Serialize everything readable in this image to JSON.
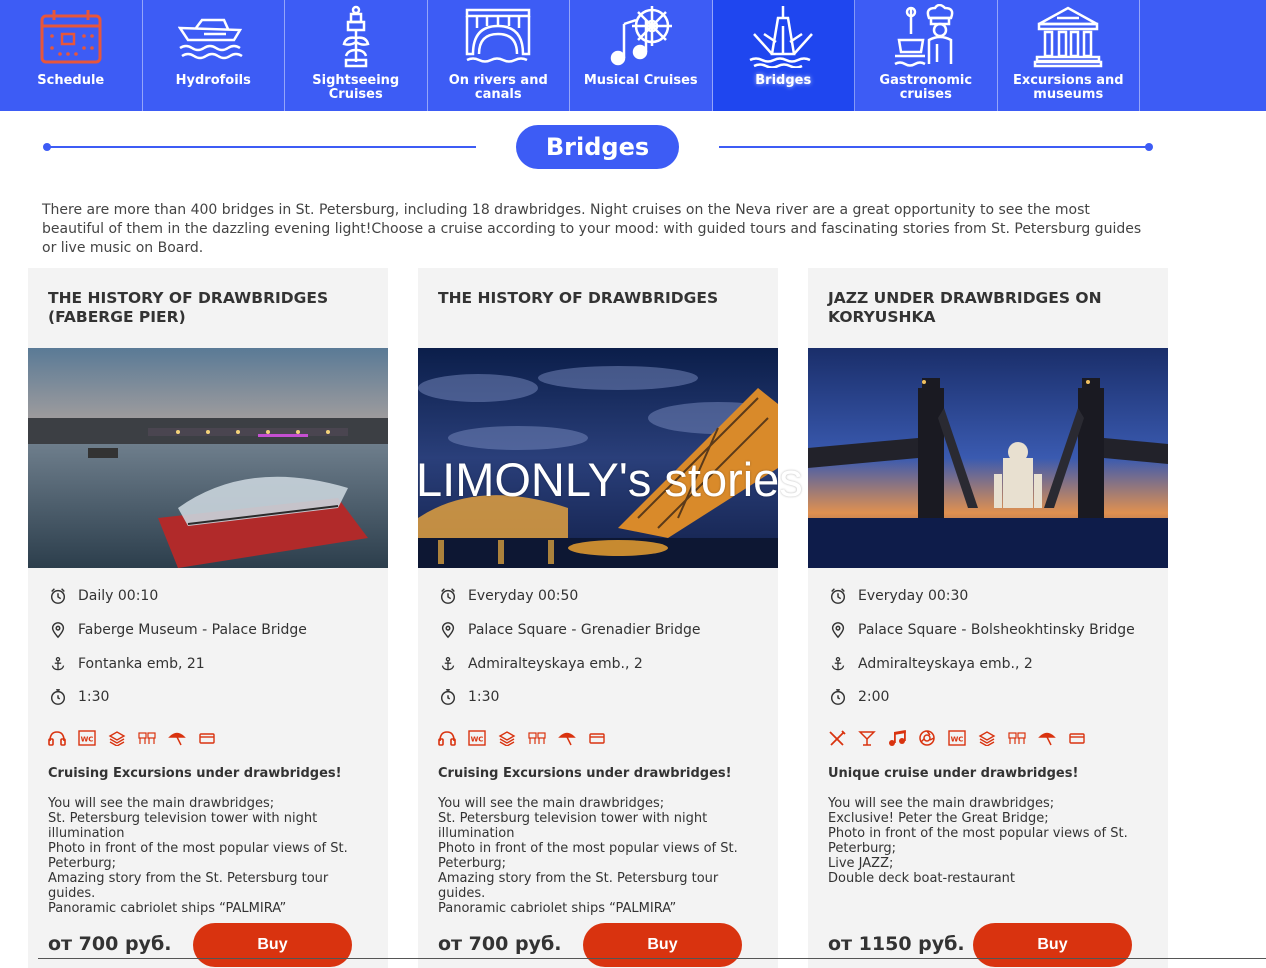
{
  "nav": {
    "items": [
      {
        "label": "Schedule",
        "icon": "calendar-icon",
        "active": false
      },
      {
        "label": "Hydrofoils",
        "icon": "hydrofoil-icon",
        "active": false
      },
      {
        "label": "Sightseeing Cruises",
        "icon": "column-icon",
        "active": false
      },
      {
        "label": "On rivers and canals",
        "icon": "canal-bridge-icon",
        "active": false
      },
      {
        "label": "Musical Cruises",
        "icon": "music-wheel-icon",
        "active": false
      },
      {
        "label": "Bridges",
        "icon": "drawbridge-icon",
        "active": true
      },
      {
        "label": "Gastronomic cruises",
        "icon": "chef-icon",
        "active": false
      },
      {
        "label": "Excursions and museums",
        "icon": "museum-icon",
        "active": false
      }
    ]
  },
  "section": {
    "title": "Bridges",
    "intro": "There are more than 400 bridges in St. Petersburg, including 18 drawbridges. Night cruises on the Neva river are a great opportunity to see the most beautiful of them in the dazzling evening light!Choose a cruise according to your mood: with guided tours and fascinating stories from St. Petersburg guides or live music on Board."
  },
  "watermark": "LIMONLY's stories",
  "colors": {
    "primary": "#3d5cf5",
    "accent": "#d9330f"
  },
  "cards": [
    {
      "title": "The history of drawbridges (Faberge Pier)",
      "schedule": "Daily 00:10",
      "route": "Faberge Museum - Palace Bridge",
      "pier": "Fontanka emb, 21",
      "duration": "1:30",
      "amenities": [
        "audio-guide-icon",
        "wc-icon",
        "deck-icon",
        "seats-icon",
        "umbrella-icon",
        "card-icon"
      ],
      "heading": "Cruising Excursions under drawbridges!",
      "desc": [
        "You will see the main drawbridges;",
        "St. Petersburg television tower with night illumination",
        "Photo in front of the most popular views of St. Peterburg;",
        "Amazing story from the St. Petersburg tour guides.",
        "Panoramic cabriolet ships “PALMIRA”"
      ],
      "price": "от 700 руб.",
      "buy": "Buy"
    },
    {
      "title": "The history of drawbridges",
      "schedule": "Everyday 00:50",
      "route": "Palace Square - Grenadier Bridge",
      "pier": "Admiralteyskaya emb., 2",
      "duration": "1:30",
      "amenities": [
        "audio-guide-icon",
        "wc-icon",
        "deck-icon",
        "seats-icon",
        "umbrella-icon",
        "card-icon"
      ],
      "heading": "Cruising Excursions under drawbridges!",
      "desc": [
        "You will see the main drawbridges;",
        "St. Petersburg television tower with night illumination",
        "Photo in front of the most popular views of St. Peterburg;",
        "Amazing story from the St. Petersburg tour guides.",
        "Panoramic cabriolet ships “PALMIRA”"
      ],
      "price": "от 700 руб.",
      "buy": "Buy"
    },
    {
      "title": "Jazz under drawbridges on Koryushka",
      "schedule": "Everyday 00:30",
      "route": "Palace Square - Bolsheokhtinsky Bridge",
      "pier": "Admiralteyskaya emb., 2",
      "duration": "2:00",
      "amenities": [
        "restaurant-icon",
        "cocktail-icon",
        "music-icon",
        "photo-icon",
        "wc-icon",
        "deck-icon",
        "seats-icon",
        "umbrella-icon",
        "card-icon"
      ],
      "heading": "Unique cruise under drawbridges!",
      "desc": [
        "You will see the main drawbridges;",
        "Exclusive! Peter the Great Bridge;",
        "Photo in front of the most popular views of St. Peterburg;",
        "Live JAZZ;",
        "Double deck boat-restaurant"
      ],
      "price": "от 1150 руб.",
      "buy": "Buy"
    }
  ]
}
